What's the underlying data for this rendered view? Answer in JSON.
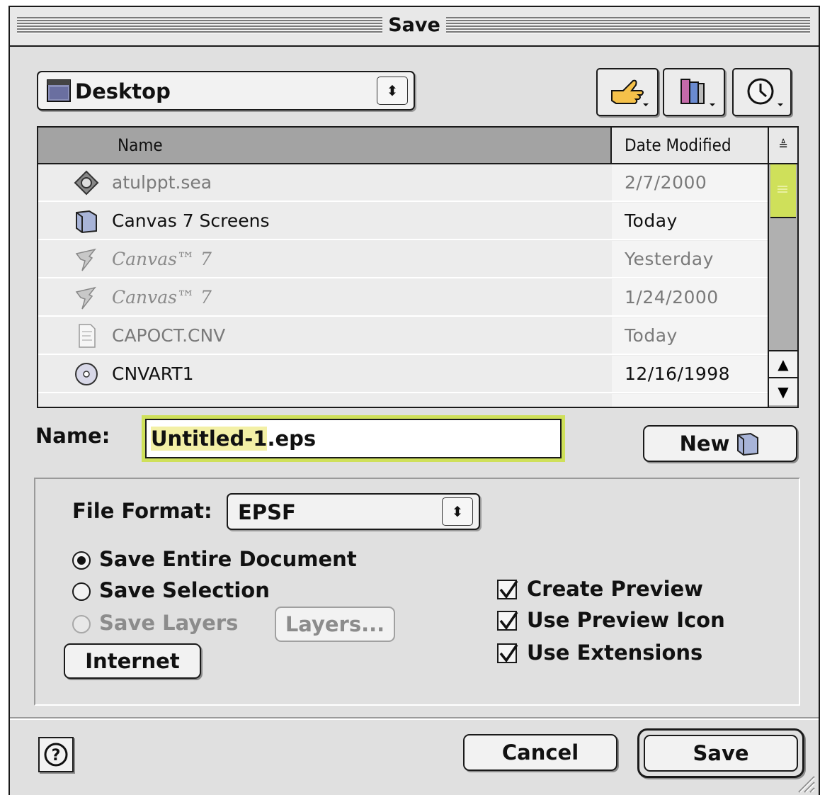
{
  "window": {
    "title": "Save"
  },
  "location": {
    "selected": "Desktop"
  },
  "toolbar": {
    "shortcuts_icon": "pointing-hand-icon",
    "favorites_icon": "favorites-books-icon",
    "recent_icon": "clock-icon"
  },
  "file_list": {
    "columns": {
      "name": "Name",
      "date": "Date Modified"
    },
    "rows": [
      {
        "name": "atulppt.sea",
        "date": "2/7/2000",
        "icon": "archive-diamond-icon"
      },
      {
        "name": "Canvas 7 Screens",
        "date": "Today",
        "icon": "folder-icon"
      },
      {
        "name": "Canvas™ 7",
        "date": "Yesterday",
        "icon": "canvas-app-icon"
      },
      {
        "name": "Canvas™ 7",
        "date": "1/24/2000",
        "icon": "canvas-app-icon"
      },
      {
        "name": "CAPOCT.CNV",
        "date": "Today",
        "icon": "document-icon"
      },
      {
        "name": "CNVART1",
        "date": "12/16/1998",
        "icon": "cd-disk-icon"
      }
    ]
  },
  "name_field": {
    "label": "Name:",
    "value_selected": "Untitled-1",
    "value_rest": ".eps"
  },
  "new_button": {
    "label": "New"
  },
  "format": {
    "label": "File Format:",
    "selected": "EPSF"
  },
  "save_scope": {
    "entire": "Save Entire Document",
    "selection": "Save Selection",
    "layers": "Save Layers"
  },
  "layers_button": {
    "label": "Layers..."
  },
  "internet_button": {
    "label": "Internet"
  },
  "checkboxes": {
    "create_preview": "Create Preview",
    "use_preview_icon": "Use Preview Icon",
    "use_extensions": "Use Extensions"
  },
  "footer": {
    "help_icon": "question-mark-icon",
    "cancel": "Cancel",
    "save": "Save"
  }
}
